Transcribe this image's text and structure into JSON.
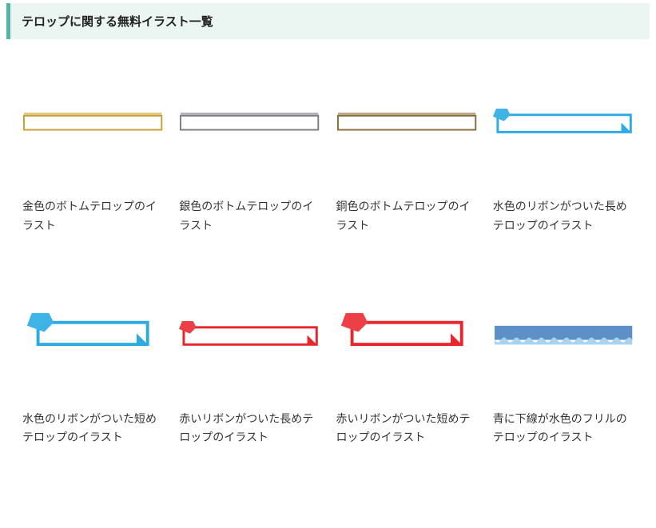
{
  "header": {
    "title": "テロップに関する無料イラスト一覧"
  },
  "items": [
    {
      "caption": "金色のボトムテロップのイラスト"
    },
    {
      "caption": "銀色のボトムテロップのイラスト"
    },
    {
      "caption": "銅色のボトムテロップのイラスト"
    },
    {
      "caption": "水色のリボンがついた長めテロップのイラスト"
    },
    {
      "caption": "水色のリボンがついた短めテロップのイラスト"
    },
    {
      "caption": "赤いリボンがついた長めテロップのイラスト"
    },
    {
      "caption": "赤いリボンがついた短めテロップのイラスト"
    },
    {
      "caption": "青に下線が水色のフリルのテロップのイラスト"
    }
  ],
  "colors": {
    "gold": "#c9a030",
    "silver": "#7b7f84",
    "bronze": "#8b6d3c",
    "skyblue": "#2daae1",
    "red": "#e8262c",
    "blue": "#5d90c7",
    "frill": "#a7d4f0"
  }
}
